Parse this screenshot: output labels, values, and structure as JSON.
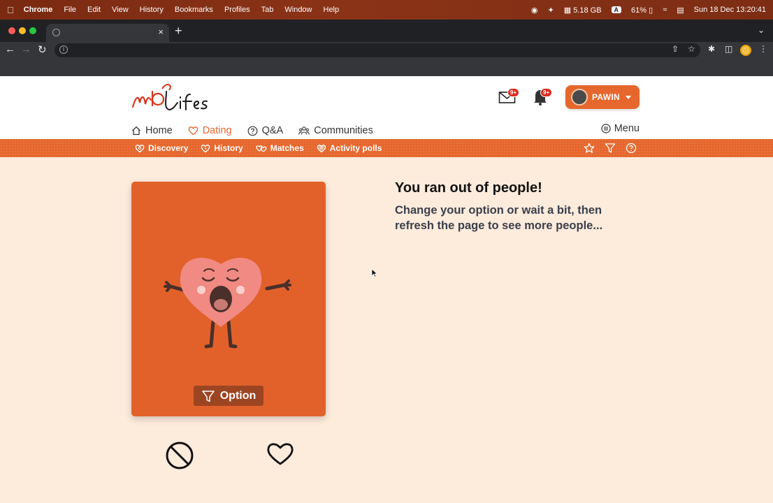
{
  "macos": {
    "app_name": "Chrome",
    "menu": [
      "File",
      "Edit",
      "View",
      "History",
      "Bookmarks",
      "Profiles",
      "Tab",
      "Window",
      "Help"
    ],
    "memory": "5.18 GB",
    "input_source": "A",
    "battery": "61%",
    "datetime": "Sun 18 Dec  13:20:41"
  },
  "browser": {
    "tab_title": "",
    "new_tab_label": "+",
    "close_label": "×",
    "url": ""
  },
  "site": {
    "logo_text": "MioLifes",
    "messages_badge": "9+",
    "notifications_badge": "9+",
    "profile_name": "PAWIN",
    "nav": [
      {
        "label": "Home",
        "icon": "home-icon"
      },
      {
        "label": "Dating",
        "icon": "heart-icon",
        "active": true
      },
      {
        "label": "Q&A",
        "icon": "question-circle-icon"
      },
      {
        "label": "Communities",
        "icon": "people-icon"
      }
    ],
    "menu_label": "Menu",
    "sub_nav": [
      {
        "label": "Discovery",
        "icon": "heart-search-icon"
      },
      {
        "label": "History",
        "icon": "heart-history-icon"
      },
      {
        "label": "Matches",
        "icon": "hearts-icon"
      },
      {
        "label": "Activity polls",
        "icon": "poll-icon"
      }
    ]
  },
  "content": {
    "option_label": "Option",
    "title": "You ran out of people!",
    "subtitle": "Change your option or wait a bit, then refresh the page to see more people..."
  },
  "colors": {
    "brand_orange": "#e6672d",
    "card_orange": "#e2612a",
    "page_bg": "#fdebdc",
    "mac_bar": "#8b3317",
    "badge_red": "#d92d20"
  }
}
